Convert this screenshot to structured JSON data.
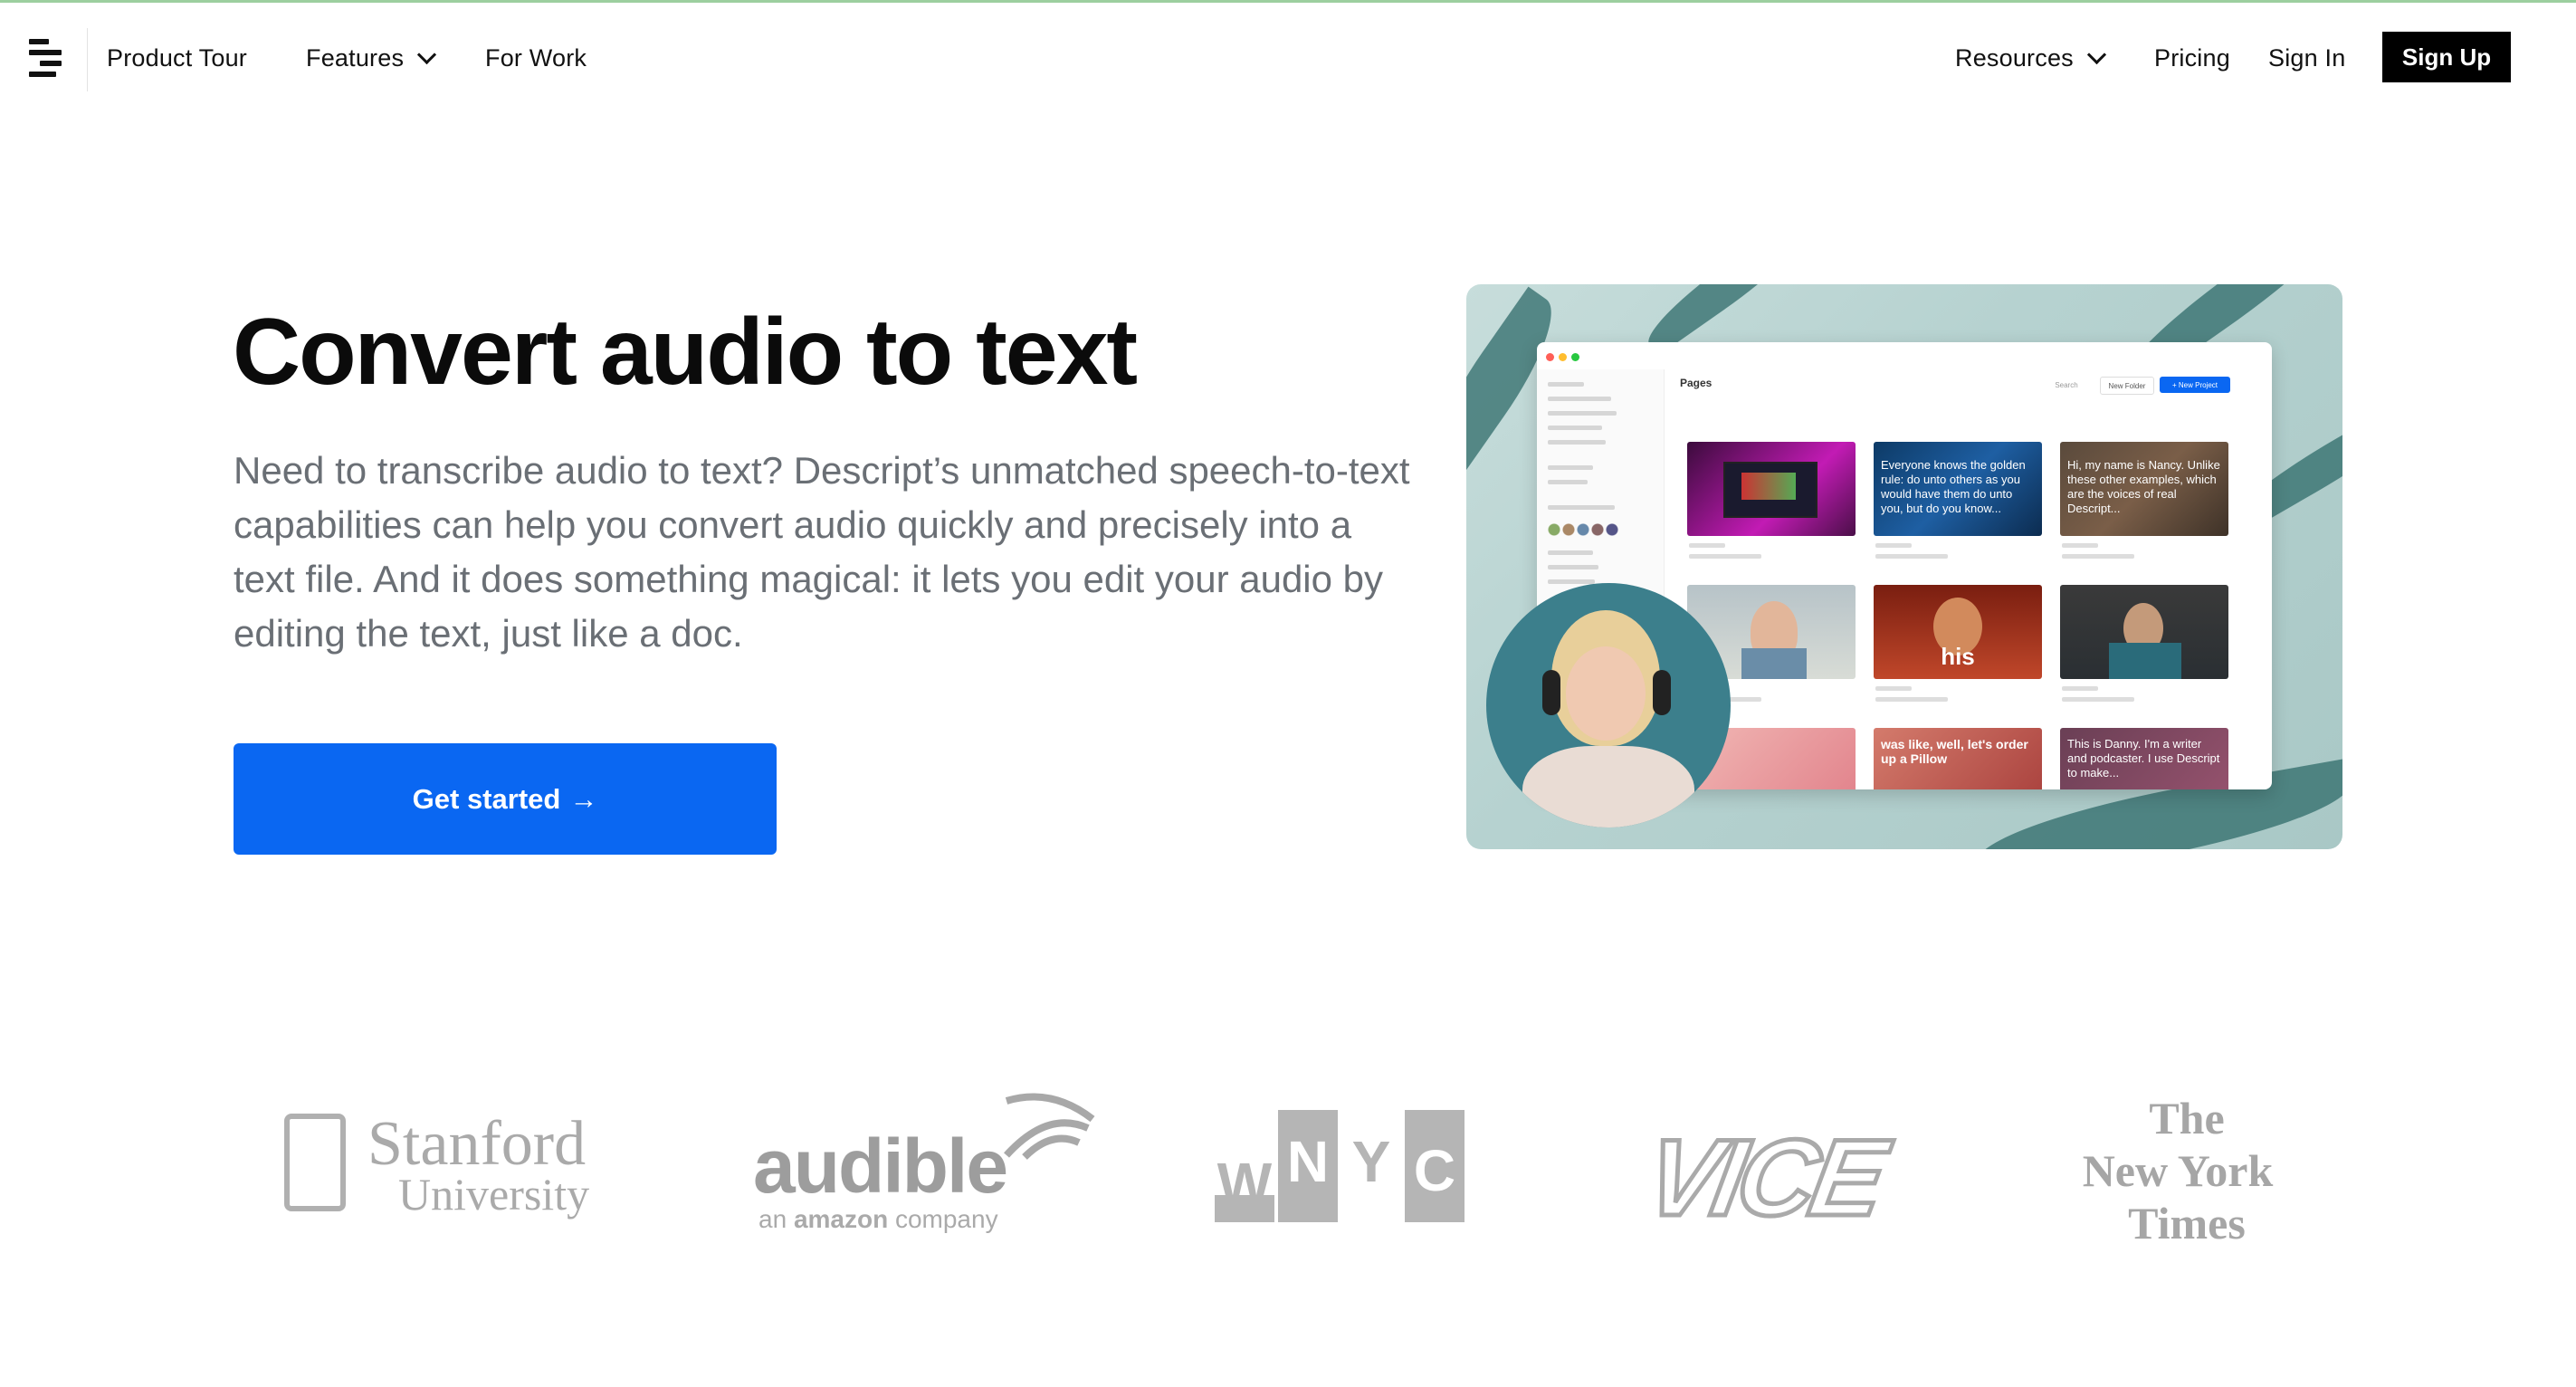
{
  "nav": {
    "logo_icon": "descript-logo-icon",
    "product_tour": "Product Tour",
    "features": "Features",
    "for_work": "For Work",
    "resources": "Resources",
    "pricing": "Pricing",
    "sign_in": "Sign In",
    "sign_up": "Sign Up"
  },
  "hero": {
    "title": "Convert audio to text",
    "subtitle": "Need to transcribe audio to text? Descript’s unmatched speech-to-text capabilities can help you convert audio quickly and precisely into a text file. And it does something magical: it lets you edit your audio by editing the text, just like a doc.",
    "cta": "Get started",
    "cta_arrow": "→",
    "cta_color": "#0a67f2"
  },
  "product_image": {
    "pages_label": "Pages",
    "search_label": "Search",
    "new_folder_label": "New Folder",
    "new_project_label": "+ New Project",
    "tiles": [
      {
        "caption": ""
      },
      {
        "caption": "Everyone knows the golden rule: do unto others as you would have them do unto you, but do you know..."
      },
      {
        "caption": "Hi, my name is Nancy. Unlike these other examples, which are the voices of real Descript..."
      },
      {
        "caption": ""
      },
      {
        "caption": "his"
      },
      {
        "caption": ""
      },
      {
        "caption": ""
      },
      {
        "caption": "was like, well, let's order up a Pillow"
      },
      {
        "caption": "This is Danny. I'm a writer and podcaster. I use Descript to make..."
      }
    ]
  },
  "logos": {
    "stanford_line1": "Stanford",
    "stanford_line2": "University",
    "audible": "audible",
    "audible_sub_pre": "an ",
    "audible_sub_brand": "amazon",
    "audible_sub_post": " company",
    "wnyc": [
      "W",
      "N",
      "Y",
      "C"
    ],
    "vice": "VICE",
    "nyt_line1": "The",
    "nyt_line2": "New York",
    "nyt_line3": "Times"
  }
}
